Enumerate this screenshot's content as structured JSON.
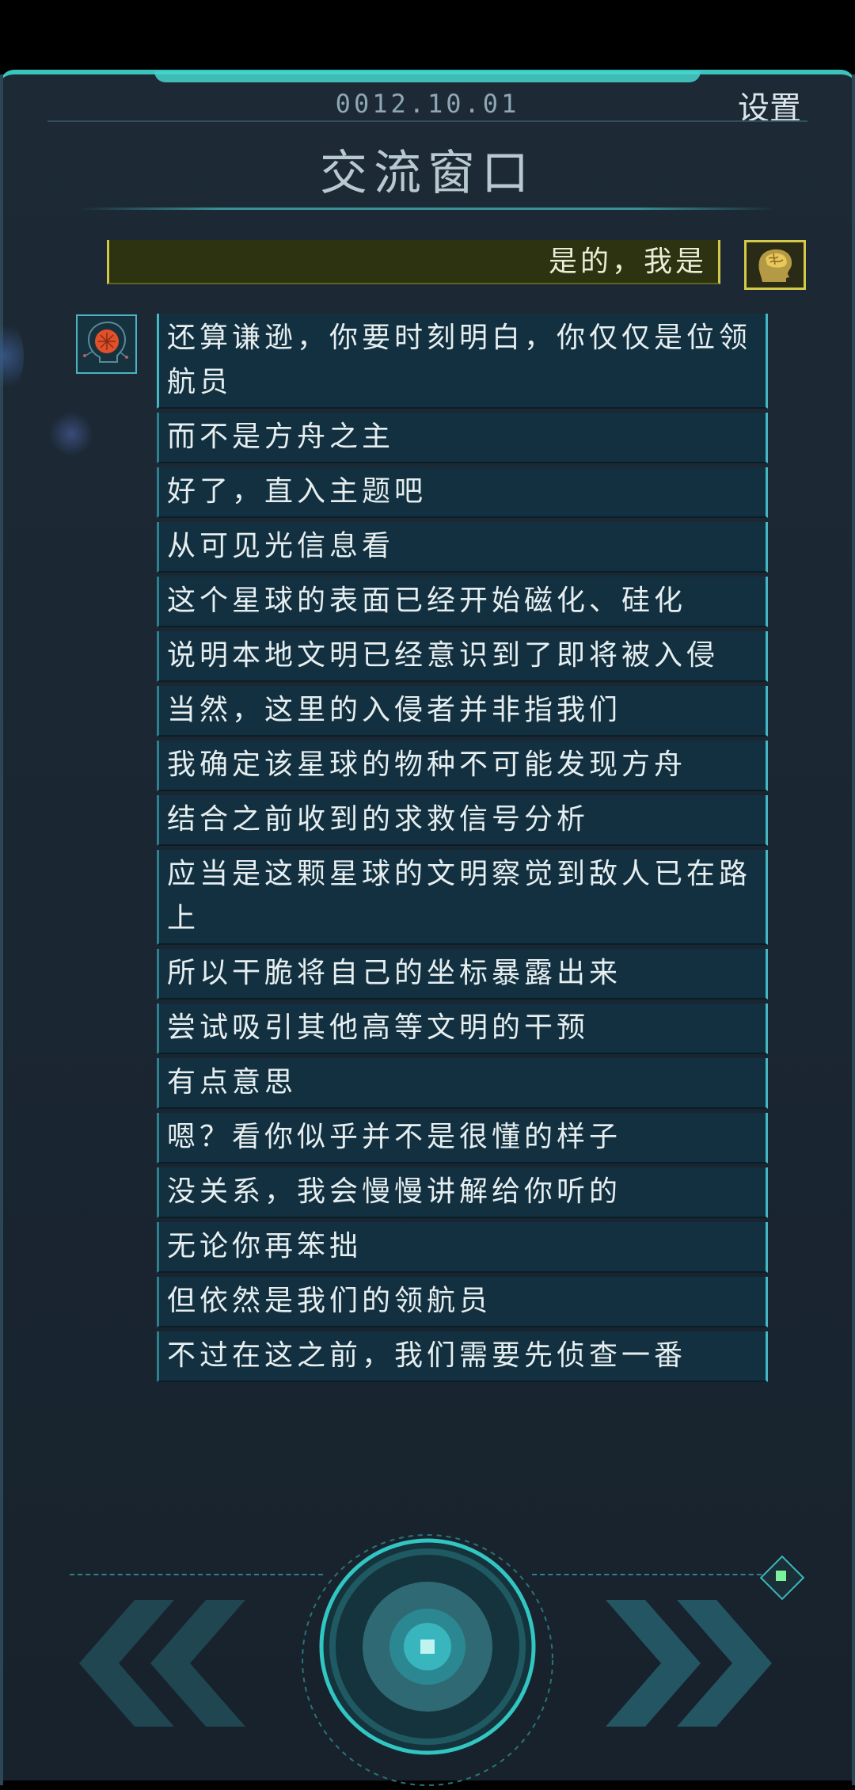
{
  "header": {
    "date": "0012.10.01",
    "settings_label": "设置",
    "title": "交流窗口"
  },
  "player_reply": "是的，我是",
  "messages": [
    "还算谦逊，你要时刻明白，你仅仅是位领航员",
    "而不是方舟之主",
    "好了，直入主题吧",
    "从可见光信息看",
    "这个星球的表面已经开始磁化、硅化",
    "说明本地文明已经意识到了即将被入侵",
    "当然，这里的入侵者并非指我们",
    "我确定该星球的物种不可能发现方舟",
    "结合之前收到的求救信号分析",
    "应当是这颗星球的文明察觉到敌人已在路上",
    "所以干脆将自己的坐标暴露出来",
    "尝试吸引其他高等文明的干预",
    "有点意思",
    "嗯？看你似乎并不是很懂的样子",
    "没关系，我会慢慢讲解给你听的",
    "无论你再笨拙",
    "但依然是我们的领航员",
    "不过在这之前，我们需要先侦查一番"
  ],
  "icons": {
    "player_avatar": "brain-head-icon",
    "ai_avatar": "red-orb-circuit-icon",
    "prev": "double-chevron-left-icon",
    "next": "double-chevron-right-icon",
    "center": "round-action-button-icon"
  },
  "colors": {
    "accent": "#3bc4bd",
    "reply_border": "#d1c84a",
    "message_bg": "#12303f"
  }
}
